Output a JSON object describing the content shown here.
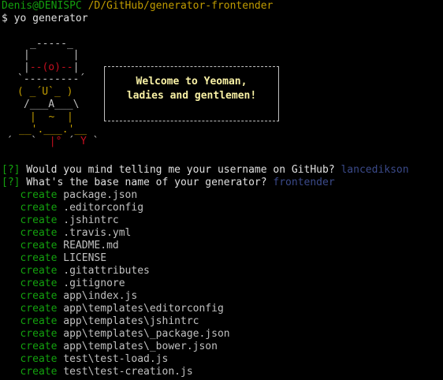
{
  "prompt": {
    "user_host": "Denis@DENISPC",
    "path": "/D/GitHub/generator-frontender",
    "symbol": "$",
    "command": "yo generator"
  },
  "banner": {
    "welcome_line1": "Welcome to Yeoman,",
    "welcome_line2": "ladies and gentlemen!"
  },
  "questions": [
    {
      "marker": "[?]",
      "text": "Would you mind telling me your username on GitHub?",
      "answer": "lancedikson"
    },
    {
      "marker": "[?]",
      "text": "What's the base name of your generator?",
      "answer": "frontender"
    }
  ],
  "create_label": "create",
  "created_files": [
    "package.json",
    ".editorconfig",
    ".jshintrc",
    ".travis.yml",
    "README.md",
    "LICENSE",
    ".gitattributes",
    ".gitignore",
    "app\\index.js",
    "app\\templates\\editorconfig",
    "app\\templates\\jshintrc",
    "app\\templates\\_package.json",
    "app\\templates\\_bower.json",
    "test\\test-load.js",
    "test\\test-creation.js"
  ],
  "colors": {
    "background": "#000000",
    "prompt_user": "#13a10e",
    "prompt_path": "#c19c00",
    "create": "#13a10e",
    "answer": "#3b4a8a",
    "welcome": "#f9f1a5",
    "mascot_red": "#c50f1f",
    "mascot_yellow": "#c19c00"
  }
}
